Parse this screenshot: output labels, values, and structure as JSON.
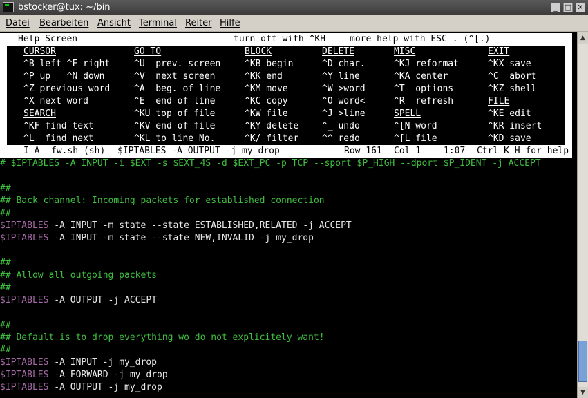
{
  "window": {
    "title": "bstocker@tux: ~/bin"
  },
  "menu": [
    "Datei",
    "Bearbeiten",
    "Ansicht",
    "Terminal",
    "Reiter",
    "Hilfe"
  ],
  "help": {
    "title": "Help Screen",
    "turn_off": "turn off with ^KH",
    "more_help": "more help with ESC . (^[.)",
    "columns": [
      {
        "header": "CURSOR",
        "items": [
          "^B left ^F right",
          "^P up   ^N down",
          "^Z previous word",
          "^X next word"
        ],
        "header2": "SEARCH",
        "items2": [
          "^KF find text",
          "^L  find next"
        ]
      },
      {
        "header": "GO TO",
        "items": [
          "^U  prev. screen",
          "^V  next screen",
          "^A  beg. of line",
          "^E  end of line",
          "^KU top of file",
          "^KV end of file",
          "^KL to line No."
        ]
      },
      {
        "header": "BLOCK",
        "items": [
          "^KB begin",
          "^KK end",
          "^KM move",
          "^KC copy",
          "^KW file",
          "^KY delete",
          "^K/ filter"
        ]
      },
      {
        "header": "DELETE",
        "items": [
          "^D char.",
          "^Y line",
          "^W >word",
          "^O word<",
          "^J >line",
          "^_ undo",
          "^^ redo"
        ]
      },
      {
        "header": "MISC",
        "items": [
          "^KJ reformat",
          "^KA center",
          "^T  options",
          "^R  refresh"
        ],
        "header2": "SPELL",
        "items2": [
          "^[N word",
          "^[L file"
        ]
      },
      {
        "header": "EXIT",
        "items": [
          "^KX save",
          "^C  abort",
          "^KZ shell"
        ],
        "header2": "FILE",
        "items2": [
          "^KE edit",
          "^KR insert",
          "^KD save"
        ]
      }
    ]
  },
  "status": {
    "mode": "I A",
    "file": "fw.sh (sh)",
    "context": "$IPTABLES -A OUTPUT -j my_drop",
    "row": "Row 161",
    "col": "Col 1",
    "time": "1:07",
    "help_hint": "Ctrl-K H for help"
  },
  "code_lines": [
    {
      "var": "",
      "text": "# $IPTABLES -A INPUT -i $EXT -s $EXT_4S -d $EXT_PC -p TCP --sport $P_HIGH --dport $P_IDENT -j ACCEPT",
      "kind": "comment"
    },
    {
      "var": "",
      "text": "",
      "kind": "blank"
    },
    {
      "var": "",
      "text": "##",
      "kind": "comment"
    },
    {
      "var": "",
      "text": "## Back channel: Incoming packets for established connection",
      "kind": "comment"
    },
    {
      "var": "",
      "text": "##",
      "kind": "comment"
    },
    {
      "var": "$IPTABLES",
      "text": " -A INPUT -m state --state ESTABLISHED,RELATED -j ACCEPT",
      "kind": "code"
    },
    {
      "var": "$IPTABLES",
      "text": " -A INPUT -m state --state NEW,INVALID -j my_drop",
      "kind": "code"
    },
    {
      "var": "",
      "text": "",
      "kind": "blank"
    },
    {
      "var": "",
      "text": "##",
      "kind": "comment"
    },
    {
      "var": "",
      "text": "## Allow all outgoing packets",
      "kind": "comment"
    },
    {
      "var": "",
      "text": "##",
      "kind": "comment"
    },
    {
      "var": "$IPTABLES",
      "text": " -A OUTPUT -j ACCEPT",
      "kind": "code"
    },
    {
      "var": "",
      "text": "",
      "kind": "blank"
    },
    {
      "var": "",
      "text": "##",
      "kind": "comment"
    },
    {
      "var": "",
      "text": "## Default is to drop everything wo do not explicitely want!",
      "kind": "comment"
    },
    {
      "var": "",
      "text": "##",
      "kind": "comment"
    },
    {
      "var": "$IPTABLES",
      "text": " -A INPUT -j my_drop",
      "kind": "code"
    },
    {
      "var": "$IPTABLES",
      "text": " -A FORWARD -j my_drop",
      "kind": "code"
    },
    {
      "var": "$IPTABLES",
      "text": " -A OUTPUT -j my_drop",
      "kind": "code"
    }
  ],
  "colors": {
    "comment": "#3fbf3f",
    "variable": "#a66aa6",
    "text": "#e8e8e8",
    "background": "#000000"
  },
  "icons": {
    "minimize": "minimize-icon",
    "maximize": "maximize-icon",
    "close": "close-icon"
  }
}
